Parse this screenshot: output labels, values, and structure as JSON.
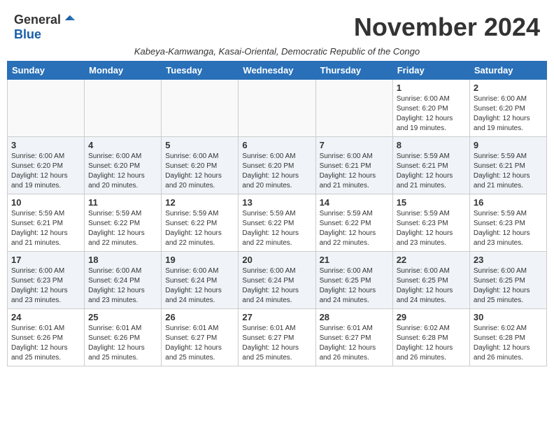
{
  "logo": {
    "general": "General",
    "blue": "Blue"
  },
  "title": "November 2024",
  "subtitle": "Kabeya-Kamwanga, Kasai-Oriental, Democratic Republic of the Congo",
  "headers": [
    "Sunday",
    "Monday",
    "Tuesday",
    "Wednesday",
    "Thursday",
    "Friday",
    "Saturday"
  ],
  "weeks": [
    [
      {
        "day": "",
        "info": ""
      },
      {
        "day": "",
        "info": ""
      },
      {
        "day": "",
        "info": ""
      },
      {
        "day": "",
        "info": ""
      },
      {
        "day": "",
        "info": ""
      },
      {
        "day": "1",
        "info": "Sunrise: 6:00 AM\nSunset: 6:20 PM\nDaylight: 12 hours and 19 minutes."
      },
      {
        "day": "2",
        "info": "Sunrise: 6:00 AM\nSunset: 6:20 PM\nDaylight: 12 hours and 19 minutes."
      }
    ],
    [
      {
        "day": "3",
        "info": "Sunrise: 6:00 AM\nSunset: 6:20 PM\nDaylight: 12 hours and 19 minutes."
      },
      {
        "day": "4",
        "info": "Sunrise: 6:00 AM\nSunset: 6:20 PM\nDaylight: 12 hours and 20 minutes."
      },
      {
        "day": "5",
        "info": "Sunrise: 6:00 AM\nSunset: 6:20 PM\nDaylight: 12 hours and 20 minutes."
      },
      {
        "day": "6",
        "info": "Sunrise: 6:00 AM\nSunset: 6:20 PM\nDaylight: 12 hours and 20 minutes."
      },
      {
        "day": "7",
        "info": "Sunrise: 6:00 AM\nSunset: 6:21 PM\nDaylight: 12 hours and 21 minutes."
      },
      {
        "day": "8",
        "info": "Sunrise: 5:59 AM\nSunset: 6:21 PM\nDaylight: 12 hours and 21 minutes."
      },
      {
        "day": "9",
        "info": "Sunrise: 5:59 AM\nSunset: 6:21 PM\nDaylight: 12 hours and 21 minutes."
      }
    ],
    [
      {
        "day": "10",
        "info": "Sunrise: 5:59 AM\nSunset: 6:21 PM\nDaylight: 12 hours and 21 minutes."
      },
      {
        "day": "11",
        "info": "Sunrise: 5:59 AM\nSunset: 6:22 PM\nDaylight: 12 hours and 22 minutes."
      },
      {
        "day": "12",
        "info": "Sunrise: 5:59 AM\nSunset: 6:22 PM\nDaylight: 12 hours and 22 minutes."
      },
      {
        "day": "13",
        "info": "Sunrise: 5:59 AM\nSunset: 6:22 PM\nDaylight: 12 hours and 22 minutes."
      },
      {
        "day": "14",
        "info": "Sunrise: 5:59 AM\nSunset: 6:22 PM\nDaylight: 12 hours and 22 minutes."
      },
      {
        "day": "15",
        "info": "Sunrise: 5:59 AM\nSunset: 6:23 PM\nDaylight: 12 hours and 23 minutes."
      },
      {
        "day": "16",
        "info": "Sunrise: 5:59 AM\nSunset: 6:23 PM\nDaylight: 12 hours and 23 minutes."
      }
    ],
    [
      {
        "day": "17",
        "info": "Sunrise: 6:00 AM\nSunset: 6:23 PM\nDaylight: 12 hours and 23 minutes."
      },
      {
        "day": "18",
        "info": "Sunrise: 6:00 AM\nSunset: 6:24 PM\nDaylight: 12 hours and 23 minutes."
      },
      {
        "day": "19",
        "info": "Sunrise: 6:00 AM\nSunset: 6:24 PM\nDaylight: 12 hours and 24 minutes."
      },
      {
        "day": "20",
        "info": "Sunrise: 6:00 AM\nSunset: 6:24 PM\nDaylight: 12 hours and 24 minutes."
      },
      {
        "day": "21",
        "info": "Sunrise: 6:00 AM\nSunset: 6:25 PM\nDaylight: 12 hours and 24 minutes."
      },
      {
        "day": "22",
        "info": "Sunrise: 6:00 AM\nSunset: 6:25 PM\nDaylight: 12 hours and 24 minutes."
      },
      {
        "day": "23",
        "info": "Sunrise: 6:00 AM\nSunset: 6:25 PM\nDaylight: 12 hours and 25 minutes."
      }
    ],
    [
      {
        "day": "24",
        "info": "Sunrise: 6:01 AM\nSunset: 6:26 PM\nDaylight: 12 hours and 25 minutes."
      },
      {
        "day": "25",
        "info": "Sunrise: 6:01 AM\nSunset: 6:26 PM\nDaylight: 12 hours and 25 minutes."
      },
      {
        "day": "26",
        "info": "Sunrise: 6:01 AM\nSunset: 6:27 PM\nDaylight: 12 hours and 25 minutes."
      },
      {
        "day": "27",
        "info": "Sunrise: 6:01 AM\nSunset: 6:27 PM\nDaylight: 12 hours and 25 minutes."
      },
      {
        "day": "28",
        "info": "Sunrise: 6:01 AM\nSunset: 6:27 PM\nDaylight: 12 hours and 26 minutes."
      },
      {
        "day": "29",
        "info": "Sunrise: 6:02 AM\nSunset: 6:28 PM\nDaylight: 12 hours and 26 minutes."
      },
      {
        "day": "30",
        "info": "Sunrise: 6:02 AM\nSunset: 6:28 PM\nDaylight: 12 hours and 26 minutes."
      }
    ]
  ]
}
